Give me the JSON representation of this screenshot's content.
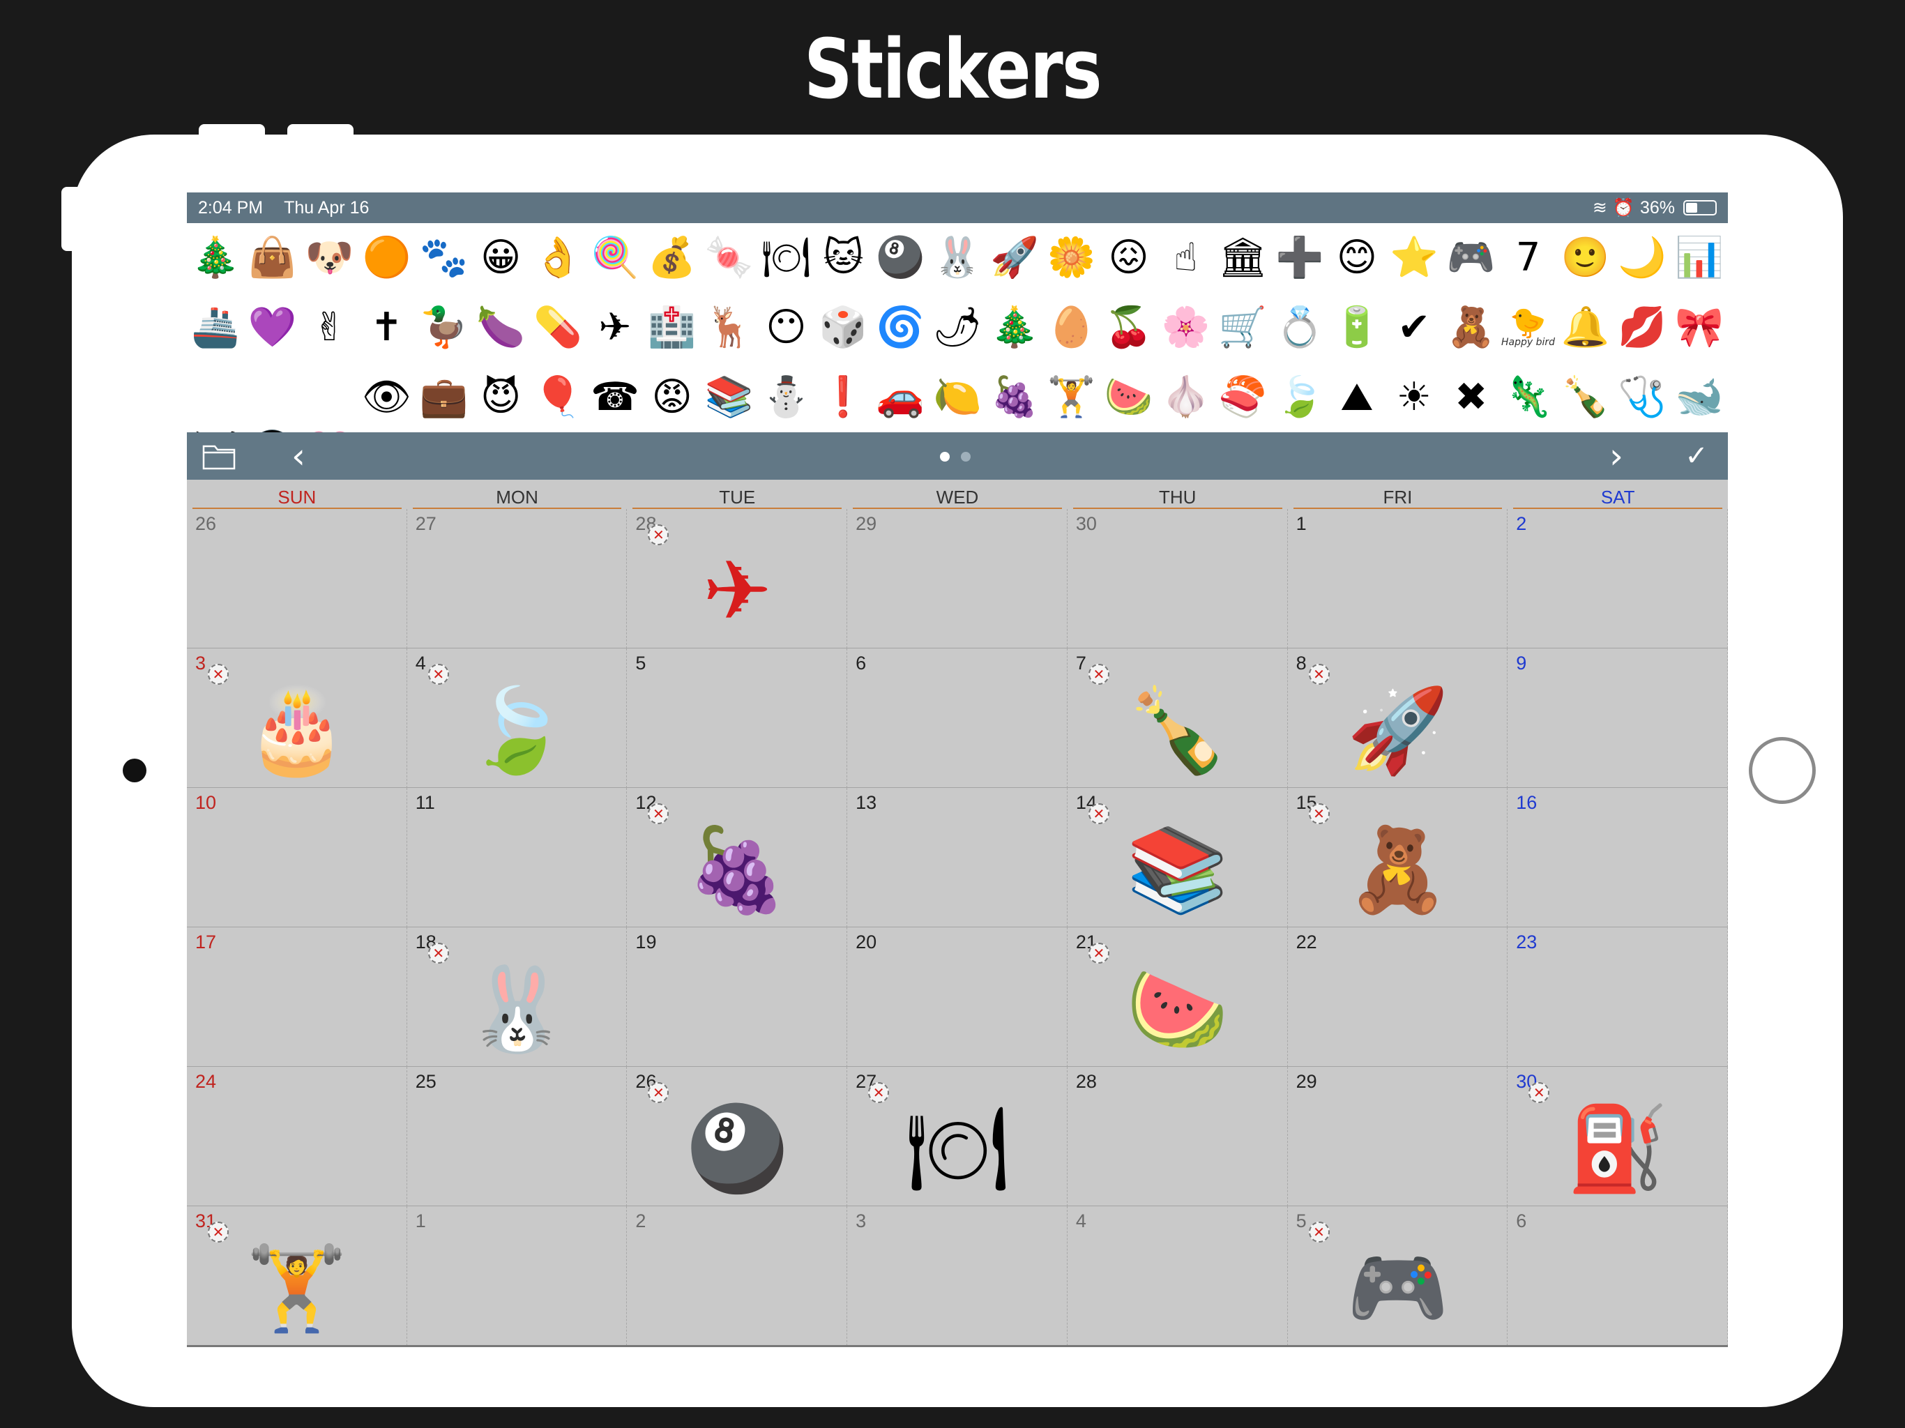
{
  "headline": "Stickers",
  "status": {
    "time": "2:04 PM",
    "date": "Thu Apr 16",
    "battery": "36%",
    "wifi_icon": "wifi-icon",
    "alarm_icon": "alarm-icon"
  },
  "palette": [
    "🎄",
    "👜",
    "🐶",
    "🟠",
    "🐾",
    "😀",
    "👌",
    "🍭",
    "💰",
    "🍬",
    "🍽",
    "🐱",
    "🎱",
    "🐰",
    "🚀",
    "🌼",
    "😖",
    "☝",
    "🏛",
    "➕",
    "😊",
    "⭐",
    "🎮",
    "7",
    "🙂",
    "🌙",
    "📊",
    "🚢",
    "💜",
    "✌",
    "✝",
    "🦆",
    "🍆",
    "💊",
    "✈",
    "🏥",
    "🦌",
    "😶",
    "🎲",
    "🌀",
    "🌶",
    "🎄",
    "🥚",
    "🍒",
    "🌸",
    "🛒",
    "💍",
    "🔋",
    "✔",
    "🧸",
    "🐤",
    "🔔",
    "💋",
    "🎀",
    "",
    "",
    "",
    "👁",
    "💼",
    "😈",
    "🎈",
    "☎",
    "😡",
    "📚",
    "⛄",
    "❗",
    "🚗",
    "🍋",
    "🍇",
    "🏋",
    "🍉",
    "🧄",
    "🍣",
    "🍃",
    "⛰",
    "☀",
    "✖",
    "🦎",
    "🍾",
    "🩺",
    "🐋",
    "🛩",
    "🚇",
    "💗"
  ],
  "palette_caption": "Happy bird",
  "toolbar": {
    "folder_icon": "folder-icon",
    "prev": "‹",
    "next": "›",
    "done": "✓"
  },
  "weekdays": [
    "SUN",
    "MON",
    "TUE",
    "WED",
    "THU",
    "FRI",
    "SAT"
  ],
  "weeks": [
    [
      "26",
      "27",
      "28",
      "29",
      "30",
      "1",
      "2"
    ],
    [
      "3",
      "4",
      "5",
      "6",
      "7",
      "8",
      "9"
    ],
    [
      "10",
      "11",
      "12",
      "13",
      "14",
      "15",
      "16"
    ],
    [
      "17",
      "18",
      "19",
      "20",
      "21",
      "22",
      "23"
    ],
    [
      "24",
      "25",
      "26",
      "27",
      "28",
      "29",
      "30"
    ],
    [
      "31",
      "1",
      "2",
      "3",
      "4",
      "5",
      "6"
    ]
  ],
  "stickers": [
    {
      "name": "airplane-sticker",
      "glyph": "✈",
      "color": "#d81d1d",
      "week": 0,
      "day": 2
    },
    {
      "name": "cake-sticker",
      "glyph": "🎂",
      "week": 1,
      "day": 0
    },
    {
      "name": "leaf-sticker",
      "glyph": "🍃",
      "week": 1,
      "day": 1
    },
    {
      "name": "bottle-sticker",
      "glyph": "🍾",
      "week": 1,
      "day": 4
    },
    {
      "name": "rocket-sticker",
      "glyph": "🚀",
      "week": 1,
      "day": 5
    },
    {
      "name": "grapes-sticker",
      "glyph": "🍇",
      "week": 2,
      "day": 2
    },
    {
      "name": "books-sticker",
      "glyph": "📚",
      "week": 2,
      "day": 4
    },
    {
      "name": "teddy-bear-sticker",
      "glyph": "🧸",
      "week": 2,
      "day": 5
    },
    {
      "name": "bunny-sticker",
      "glyph": "🐰",
      "week": 3,
      "day": 1
    },
    {
      "name": "watermelon-sticker",
      "glyph": "🍉",
      "week": 3,
      "day": 4
    },
    {
      "name": "eight-ball-sticker",
      "glyph": "🎱",
      "week": 4,
      "day": 2
    },
    {
      "name": "sushi-plate-sticker",
      "glyph": "🍽",
      "week": 4,
      "day": 3
    },
    {
      "name": "fuel-gauge-sticker",
      "glyph": "⛽",
      "week": 4,
      "day": 6
    },
    {
      "name": "dumbbell-sticker",
      "glyph": "🏋",
      "week": 5,
      "day": 0
    },
    {
      "name": "gamepad-sticker",
      "glyph": "🎮",
      "week": 5,
      "day": 5
    }
  ]
}
